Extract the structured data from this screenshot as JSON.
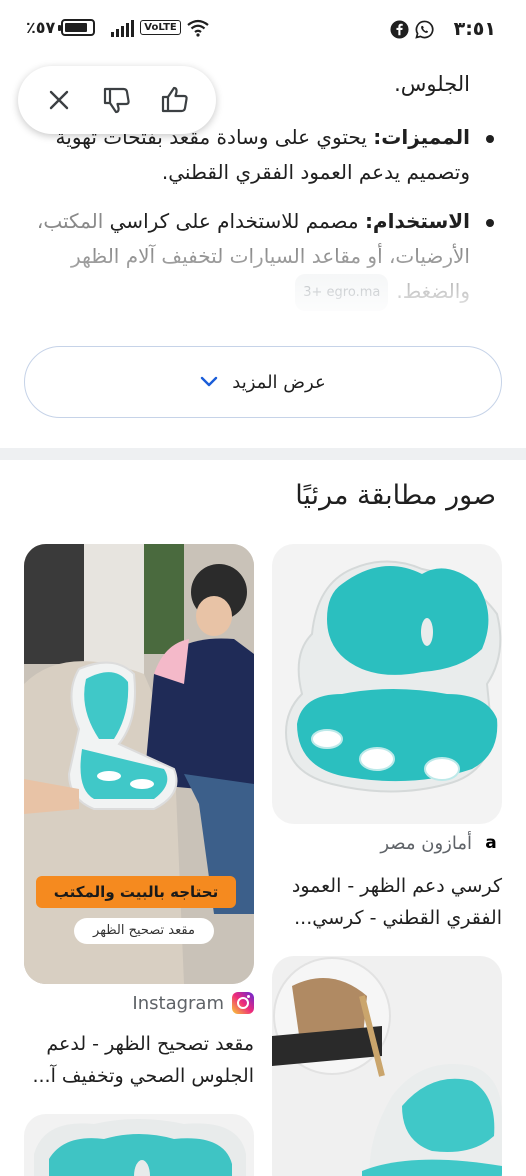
{
  "status_bar": {
    "time": "٣:٥١",
    "battery": "٪٥٧"
  },
  "content": {
    "intro_tail": "الجلوس.",
    "bullets": [
      {
        "label": "المميزات:",
        "text": " يحتوي على وسادة مقعد بفتحات تهوية وتصميم يدعم العمود الفقري القطني."
      },
      {
        "label": "الاستخدام:",
        "text_visible": " مصمم للاستخدام على كراسي ",
        "text_faded": "المكتب، الأرضيات، أو مقاعد السيارات لتخفيف آلام الظهر والضغط.",
        "source_chip": "3+ egro.ma"
      }
    ]
  },
  "show_more": {
    "label": "عرض المزيد"
  },
  "visual_matches": {
    "title": "صور مطابقة مرئيًا",
    "cards": [
      {
        "source": "أمازون مصر",
        "title": "كرسي دعم الظهر - العمود الفقري القطني - كرسي..."
      },
      {
        "source": "Instagram",
        "title": "مقعد تصحيح الظهر - لدعم الجلوس الصحي وتخفيف آ...",
        "overlay_banner": "تحتاجه بالبيت والمكتب",
        "overlay_sub": "مقعد تصحيح الظهر"
      }
    ]
  },
  "colors": {
    "accent_teal": "#2bbfbf",
    "pill_border": "#c6d3e8",
    "chevron_blue": "#1a5dd8"
  }
}
